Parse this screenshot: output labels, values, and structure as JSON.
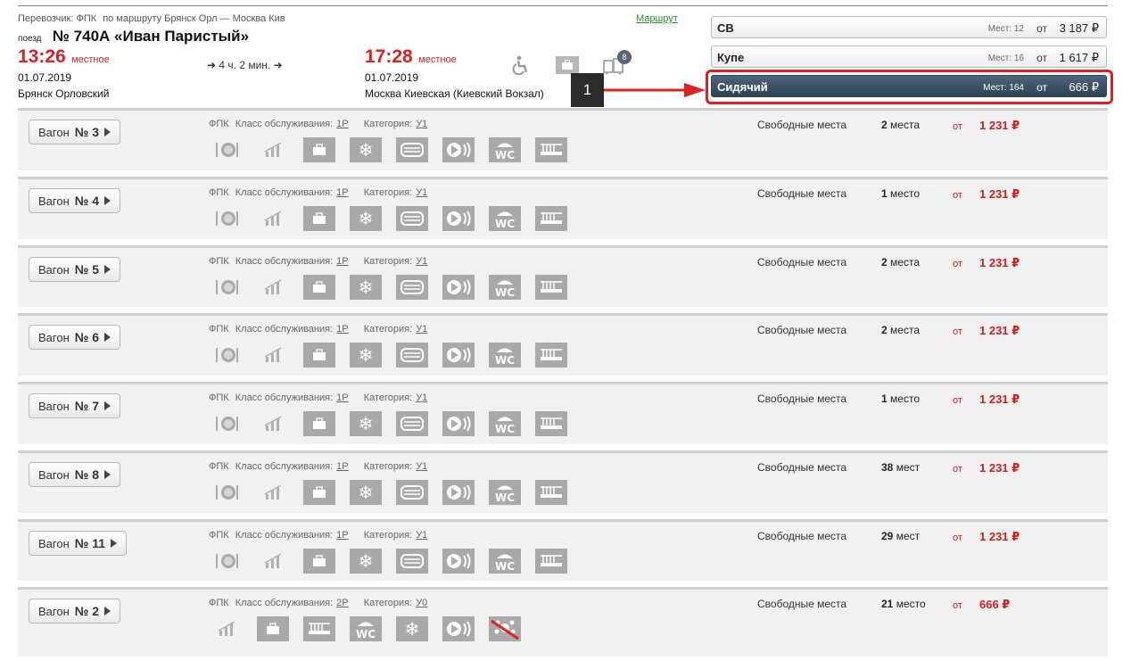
{
  "header": {
    "carrier_label": "Перевозчик: ФПК",
    "route_label": "по маршруту Брянск Орл — Москва Кив",
    "route_link": "Маршрут",
    "train_prefix": "поезд",
    "train_name": "№ 740А «Иван Паристый»",
    "departure": {
      "time": "13:26",
      "tz": "местное",
      "date": "01.07.2019",
      "station": "Брянск Орловский"
    },
    "arrival": {
      "time": "17:28",
      "tz": "местное",
      "date": "01.07.2019",
      "station": "Москва Киевская (Киевский Вокзал)"
    },
    "duration": "4 ч. 2 мин.",
    "features": {
      "icons": [
        "wheelchair-icon",
        "baggage-icon",
        "luggage-icon"
      ],
      "luggage_count": "8"
    }
  },
  "classes": [
    {
      "name": "СВ",
      "seats_label": "Мест: 12",
      "from": "от",
      "price": "3 187 ₽",
      "selected": false
    },
    {
      "name": "Купе",
      "seats_label": "Мест: 16",
      "from": "от",
      "price": "1 617 ₽",
      "selected": false
    },
    {
      "name": "Сидячий",
      "seats_label": "Мест: 164",
      "from": "от",
      "price": "666 ₽",
      "selected": true
    }
  ],
  "annotation": {
    "marker": "1",
    "highlight_color": "#e02020"
  },
  "cars": [
    {
      "label": "Вагон",
      "num": "№ 3",
      "carrier": "ФПК",
      "service_label": "Класс обслуживания:",
      "service": "1Р",
      "category_label": "Категория:",
      "category": "У1",
      "icons": [
        "meal-icon",
        "tv-icon",
        "bag-icon",
        "snowflake-icon",
        "linen-icon",
        "media-icon",
        "wc-icon",
        "hygiene-icon"
      ],
      "free_label": "Свободные места",
      "seats_num": "2",
      "seats_word": "места",
      "from": "от",
      "price": "1 231 ₽"
    },
    {
      "label": "Вагон",
      "num": "№ 4",
      "carrier": "ФПК",
      "service_label": "Класс обслуживания:",
      "service": "1Р",
      "category_label": "Категория:",
      "category": "У1",
      "icons": [
        "meal-icon",
        "tv-icon",
        "bag-icon",
        "snowflake-icon",
        "linen-icon",
        "media-icon",
        "wc-icon",
        "hygiene-icon"
      ],
      "free_label": "Свободные места",
      "seats_num": "1",
      "seats_word": "место",
      "from": "от",
      "price": "1 231 ₽"
    },
    {
      "label": "Вагон",
      "num": "№ 5",
      "carrier": "ФПК",
      "service_label": "Класс обслуживания:",
      "service": "1Р",
      "category_label": "Категория:",
      "category": "У1",
      "icons": [
        "meal-icon",
        "tv-icon",
        "bag-icon",
        "snowflake-icon",
        "linen-icon",
        "media-icon",
        "wc-icon",
        "hygiene-icon"
      ],
      "free_label": "Свободные места",
      "seats_num": "2",
      "seats_word": "места",
      "from": "от",
      "price": "1 231 ₽"
    },
    {
      "label": "Вагон",
      "num": "№ 6",
      "carrier": "ФПК",
      "service_label": "Класс обслуживания:",
      "service": "1Р",
      "category_label": "Категория:",
      "category": "У1",
      "icons": [
        "meal-icon",
        "tv-icon",
        "bag-icon",
        "snowflake-icon",
        "linen-icon",
        "media-icon",
        "wc-icon",
        "hygiene-icon"
      ],
      "free_label": "Свободные места",
      "seats_num": "2",
      "seats_word": "места",
      "from": "от",
      "price": "1 231 ₽"
    },
    {
      "label": "Вагон",
      "num": "№ 7",
      "carrier": "ФПК",
      "service_label": "Класс обслуживания:",
      "service": "1Р",
      "category_label": "Категория:",
      "category": "У1",
      "icons": [
        "meal-icon",
        "tv-icon",
        "bag-icon",
        "snowflake-icon",
        "linen-icon",
        "media-icon",
        "wc-icon",
        "hygiene-icon"
      ],
      "free_label": "Свободные места",
      "seats_num": "1",
      "seats_word": "место",
      "from": "от",
      "price": "1 231 ₽"
    },
    {
      "label": "Вагон",
      "num": "№ 8",
      "carrier": "ФПК",
      "service_label": "Класс обслуживания:",
      "service": "1Р",
      "category_label": "Категория:",
      "category": "У1",
      "icons": [
        "meal-icon",
        "tv-icon",
        "bag-icon",
        "snowflake-icon",
        "linen-icon",
        "media-icon",
        "wc-icon",
        "hygiene-icon"
      ],
      "free_label": "Свободные места",
      "seats_num": "38",
      "seats_word": "мест",
      "from": "от",
      "price": "1 231 ₽"
    },
    {
      "label": "Вагон",
      "num": "№ 11",
      "carrier": "ФПК",
      "service_label": "Класс обслуживания:",
      "service": "1Р",
      "category_label": "Категория:",
      "category": "У1",
      "icons": [
        "meal-icon",
        "tv-icon",
        "bag-icon",
        "snowflake-icon",
        "linen-icon",
        "media-icon",
        "wc-icon",
        "hygiene-icon"
      ],
      "free_label": "Свободные места",
      "seats_num": "29",
      "seats_word": "мест",
      "from": "от",
      "price": "1 231 ₽"
    },
    {
      "label": "Вагон",
      "num": "№ 2",
      "carrier": "ФПК",
      "service_label": "Класс обслуживания:",
      "service": "2Р",
      "category_label": "Категория:",
      "category": "У0",
      "icons": [
        "tv-icon",
        "bag-icon",
        "hygiene-icon",
        "wc-icon",
        "snowflake-icon",
        "media-icon",
        "no-pets-icon"
      ],
      "free_label": "Свободные места",
      "seats_num": "21",
      "seats_word": "место",
      "from": "от",
      "price": "666 ₽"
    }
  ]
}
